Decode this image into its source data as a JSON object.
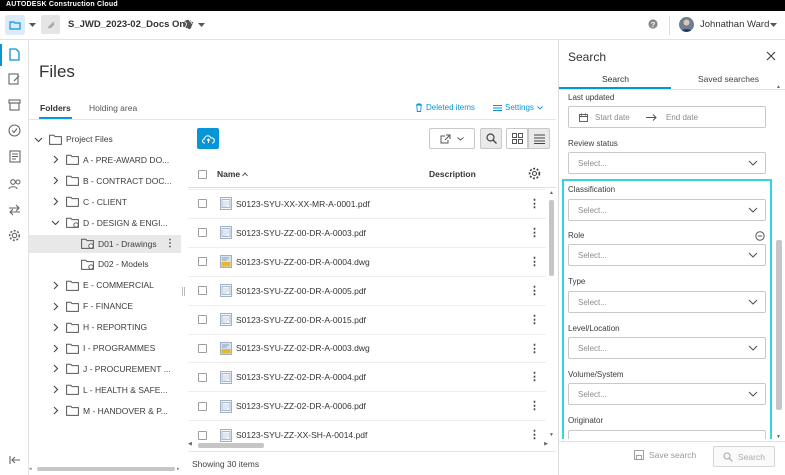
{
  "app": {
    "brand": "AUTODESK Construction Cloud"
  },
  "header": {
    "project_name": "S_JWD_2023-02_Docs Only",
    "user_name": "Johnathan Ward"
  },
  "files": {
    "title": "Files",
    "tabs": [
      "Folders",
      "Holding area"
    ],
    "deleted_items": "Deleted items",
    "settings": "Settings",
    "tree": [
      {
        "label": "Project Files",
        "level": 0,
        "expanded": true,
        "type": "root"
      },
      {
        "label": "A - PRE-AWARD DO...",
        "level": 1
      },
      {
        "label": "B - CONTRACT DOC...",
        "level": 1
      },
      {
        "label": "C - CLIENT",
        "level": 1
      },
      {
        "label": "D - DESIGN & ENGI...",
        "level": 1,
        "expanded": true
      },
      {
        "label": "D01 - Drawings",
        "level": 2,
        "selected": true
      },
      {
        "label": "D02 - Models",
        "level": 2
      },
      {
        "label": "E - COMMERCIAL",
        "level": 1
      },
      {
        "label": "F - FINANCE",
        "level": 1
      },
      {
        "label": "H - REPORTING",
        "level": 1
      },
      {
        "label": "I - PROGRAMMES",
        "level": 1
      },
      {
        "label": "J - PROCUREMENT ...",
        "level": 1
      },
      {
        "label": "L - HEALTH & SAFE...",
        "level": 1
      },
      {
        "label": "M - HANDOVER & P...",
        "level": 1
      }
    ],
    "columns": {
      "name": "Name",
      "description": "Description"
    },
    "rows": [
      {
        "name": "S0123-SYU-XX-XX-MR-A-0001.pdf",
        "kind": "pdf"
      },
      {
        "name": "S0123-SYU-ZZ-00-DR-A-0003.pdf",
        "kind": "pdf"
      },
      {
        "name": "S0123-SYU-ZZ-00-DR-A-0004.dwg",
        "kind": "dwg"
      },
      {
        "name": "S0123-SYU-ZZ-00-DR-A-0005.pdf",
        "kind": "pdf"
      },
      {
        "name": "S0123-SYU-ZZ-00-DR-A-0015.pdf",
        "kind": "pdf"
      },
      {
        "name": "S0123-SYU-ZZ-02-DR-A-0003.dwg",
        "kind": "dwg"
      },
      {
        "name": "S0123-SYU-ZZ-02-DR-A-0004.pdf",
        "kind": "pdf"
      },
      {
        "name": "S0123-SYU-ZZ-02-DR-A-0006.pdf",
        "kind": "pdf"
      },
      {
        "name": "S0123-SYU-ZZ-XX-SH-A-0014.pdf",
        "kind": "pdf"
      }
    ],
    "footer": "Showing 30 items"
  },
  "search": {
    "title": "Search",
    "tabs": [
      "Search",
      "Saved searches"
    ],
    "last_updated": {
      "label": "Last updated",
      "start": "Start date",
      "end": "End date"
    },
    "fields": [
      {
        "label": "Review status",
        "placeholder": "Select..."
      },
      {
        "label": "Classification",
        "placeholder": "Select..."
      },
      {
        "label": "Role",
        "placeholder": "Select..."
      },
      {
        "label": "Type",
        "placeholder": "Select..."
      },
      {
        "label": "Level/Location",
        "placeholder": "Select..."
      },
      {
        "label": "Volume/System",
        "placeholder": "Select..."
      },
      {
        "label": "Originator",
        "placeholder": ""
      }
    ],
    "save_search": "Save search",
    "search_button": "Search"
  },
  "colors": {
    "accent": "#0696d7",
    "highlight": "#33d6e0"
  }
}
